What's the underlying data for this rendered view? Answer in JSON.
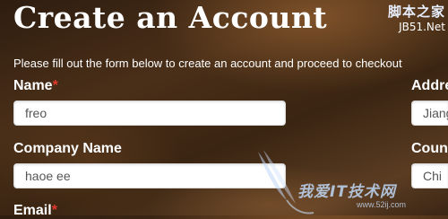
{
  "page": {
    "title": "Create an Account",
    "intro": "Please fill out the form below to create an account and proceed to checkout"
  },
  "form": {
    "name": {
      "label": "Name",
      "required_mark": "*",
      "value": "freo"
    },
    "address": {
      "label": "Addre",
      "value": "Jiang"
    },
    "company": {
      "label": "Company Name",
      "value": "haoe ee"
    },
    "country": {
      "label": "Coun",
      "value": "Chi"
    },
    "email": {
      "label": "Email",
      "required_mark": "*"
    }
  },
  "watermarks": {
    "top_line1": "脚本之家",
    "top_line2": "JB51.Net",
    "bottom_brand": "我爱IT技术网",
    "bottom_url": "www.52ij.com"
  },
  "colors": {
    "required": "#e03a2f",
    "input_background": "#ffffff",
    "input_text": "#555555"
  }
}
